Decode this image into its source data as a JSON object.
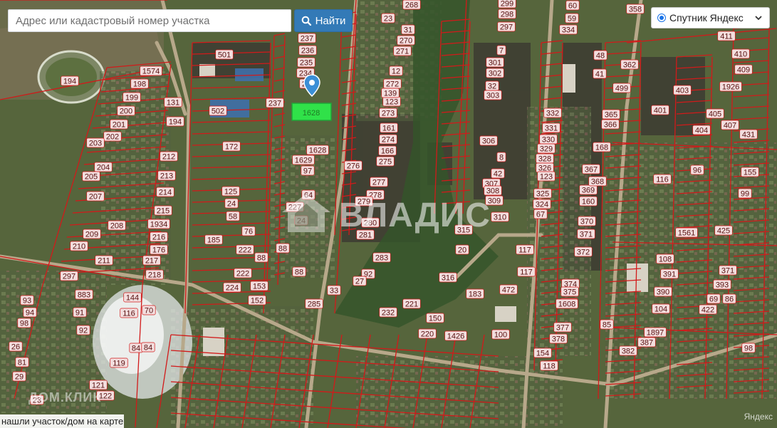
{
  "search": {
    "placeholder": "Адрес или кадастровый номер участка",
    "button_label": "Найти"
  },
  "layer_switch": {
    "selected": "Спутник Яндекс"
  },
  "bottom_link": "нашли участок/дом на карте?",
  "watermark": "ВЛАДИС",
  "corner_logo": "ДОМ.КЛИК",
  "copyright": "Яндекс",
  "selected_plot_label": "1628",
  "colors": {
    "boundary": "#d21a1a",
    "label_bg": "#f2dede",
    "selected_plot": "#2ee84a",
    "marker": "#3b8fd6",
    "button": "#337ab7"
  },
  "plot_labels": [
    "1574",
    "198",
    "199",
    "200",
    "201",
    "202",
    "203",
    "204",
    "205",
    "207",
    "208",
    "209",
    "210",
    "211",
    "297",
    "883",
    "93",
    "94",
    "98",
    "26",
    "81",
    "29",
    "92",
    "91",
    "116",
    "144",
    "70",
    "84",
    "119",
    "121",
    "122",
    "23",
    "194",
    "131",
    "194S",
    "212",
    "213",
    "214",
    "215",
    "1934",
    "216",
    "176",
    "217",
    "218",
    "501",
    "502",
    "172",
    "125",
    "24",
    "58",
    "76",
    "185",
    "222",
    "222b",
    "224",
    "153",
    "152",
    "88",
    "84",
    "88",
    "88",
    "237",
    "236",
    "235",
    "234",
    "233",
    "1628",
    "97",
    "64",
    "227",
    "24",
    "1629",
    "237b",
    "285",
    "33",
    "92",
    "27",
    "268",
    "23",
    "31",
    "270",
    "271",
    "12",
    "272",
    "123",
    "139",
    "273",
    "161",
    "274",
    "166",
    "275",
    "276",
    "277",
    "278",
    "279",
    "280",
    "281",
    "283",
    "299",
    "298",
    "297",
    "7",
    "301",
    "302",
    "32",
    "303",
    "306",
    "8",
    "42",
    "307",
    "308",
    "309",
    "310",
    "315",
    "20",
    "316",
    "221",
    "232",
    "150",
    "183",
    "472",
    "1426",
    "100",
    "117",
    "117b",
    "220",
    "60",
    "59",
    "334",
    "48",
    "41",
    "499",
    "362",
    "332",
    "331",
    "330",
    "329",
    "328",
    "326",
    "123",
    "325",
    "324",
    "67",
    "365",
    "366",
    "168",
    "367",
    "369",
    "368",
    "160",
    "370",
    "371",
    "372",
    "374",
    "375",
    "132",
    "1608",
    "377",
    "378",
    "154",
    "118",
    "85",
    "358",
    "411",
    "410",
    "409",
    "1926",
    "403",
    "401",
    "404",
    "405",
    "407",
    "431",
    "96",
    "116",
    "155",
    "99",
    "1561",
    "425",
    "108",
    "391",
    "390",
    "104",
    "1897",
    "387",
    "382",
    "422",
    "69",
    "86",
    "393",
    "371",
    "98"
  ]
}
